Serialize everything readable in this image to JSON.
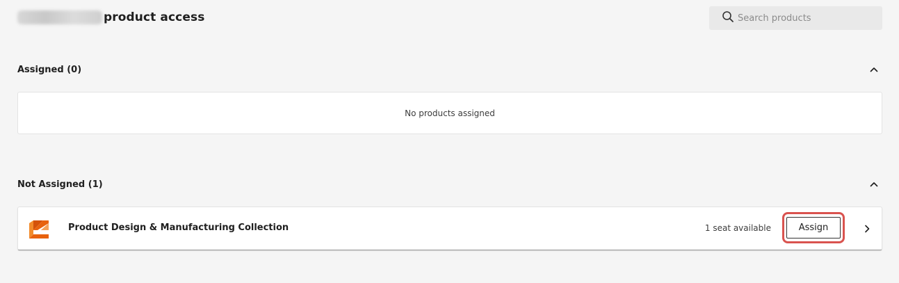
{
  "header": {
    "title": "product access"
  },
  "search": {
    "placeholder": "Search products",
    "value": ""
  },
  "sections": {
    "assigned": {
      "title": "Assigned (0)",
      "empty_message": "No products assigned"
    },
    "not_assigned": {
      "title": "Not Assigned (1)",
      "products": [
        {
          "name": "Product Design & Manufacturing Collection",
          "seats": "1 seat available",
          "action_label": "Assign"
        }
      ]
    }
  },
  "icons": {
    "search": "search-icon",
    "collapse": "chevron-up-icon",
    "row_expand": "chevron-right-icon",
    "product_logo": "pdmc-logo-icon"
  },
  "colors": {
    "background": "#f5f5f5",
    "highlight": "#d9534f",
    "logo_orange": "#e8620e"
  }
}
